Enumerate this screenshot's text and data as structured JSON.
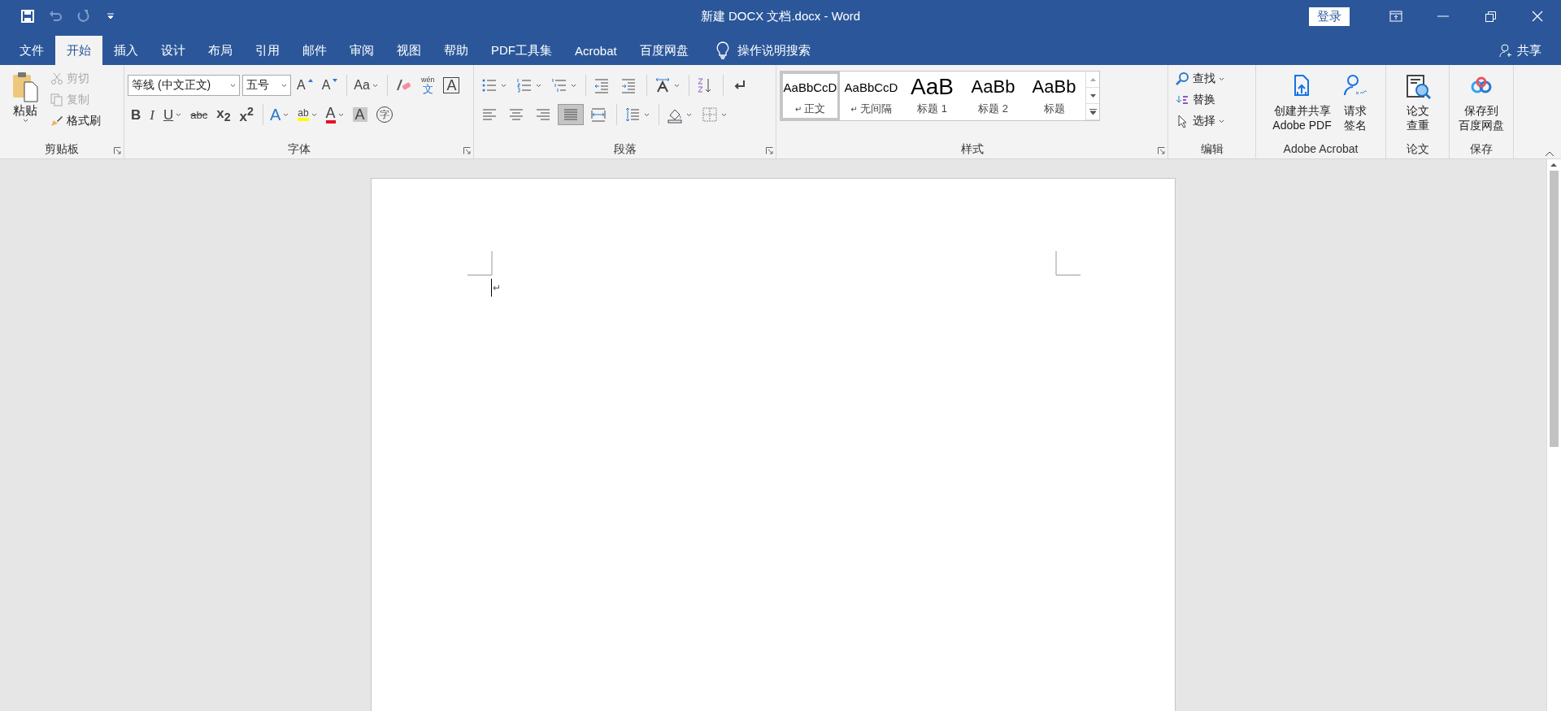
{
  "window": {
    "title": "新建 DOCX 文档.docx  -  Word",
    "sign_in": "登录"
  },
  "quick_access": [
    {
      "kind": "save",
      "disabled": false
    },
    {
      "kind": "undo",
      "disabled": true
    },
    {
      "kind": "redo",
      "disabled": true
    },
    {
      "kind": "customize",
      "disabled": false
    }
  ],
  "tabs": [
    {
      "label": "文件",
      "selected": false
    },
    {
      "label": "开始",
      "selected": true
    },
    {
      "label": "插入",
      "selected": false
    },
    {
      "label": "设计",
      "selected": false
    },
    {
      "label": "布局",
      "selected": false
    },
    {
      "label": "引用",
      "selected": false
    },
    {
      "label": "邮件",
      "selected": false
    },
    {
      "label": "审阅",
      "selected": false
    },
    {
      "label": "视图",
      "selected": false
    },
    {
      "label": "帮助",
      "selected": false
    },
    {
      "label": "PDF工具集",
      "selected": false
    },
    {
      "label": "Acrobat",
      "selected": false
    },
    {
      "label": "百度网盘",
      "selected": false
    }
  ],
  "tell_me": "操作说明搜索",
  "share": "共享",
  "clipboard": {
    "label": "剪贴板",
    "paste": "粘贴",
    "items": [
      {
        "kind": "cut",
        "label": "剪切",
        "disabled": true
      },
      {
        "kind": "copy",
        "label": "复制",
        "disabled": true
      },
      {
        "kind": "painter",
        "label": "格式刷",
        "disabled": false
      }
    ]
  },
  "font": {
    "label": "字体",
    "name": "等线 (中文正文)",
    "size": "五号",
    "row1": [
      {
        "kind": "grow",
        "glyph": "A",
        "dropdown": false,
        "sep": false
      },
      {
        "kind": "shrink",
        "glyph": "A",
        "dropdown": false,
        "sep": false
      },
      {
        "kind": "case",
        "glyph": "Aa",
        "dropdown": true,
        "sep": true
      },
      {
        "kind": "clear",
        "dropdown": false,
        "sep": true
      },
      {
        "kind": "pinyin",
        "glyph": "文",
        "top": "wén",
        "dropdown": false,
        "sep": false
      },
      {
        "kind": "boxed",
        "glyph": "A",
        "dropdown": false,
        "sep": false
      }
    ],
    "row2": [
      {
        "kind": "bold",
        "glyph": "B",
        "dropdown": false,
        "sep": false
      },
      {
        "kind": "italic",
        "glyph": "I",
        "dropdown": false,
        "sep": false
      },
      {
        "kind": "underline",
        "glyph": "U",
        "dropdown": true,
        "sep": false
      },
      {
        "kind": "strike",
        "glyph": "abc",
        "dropdown": false,
        "sep": false
      },
      {
        "kind": "script",
        "glyph": "x$_{2}$",
        "dropdown": false,
        "sep": false
      },
      {
        "kind": "script",
        "glyph": "x$^{2}$",
        "dropdown": false,
        "sep": false
      },
      {
        "kind": "outline",
        "glyph": "A",
        "dropdown": true,
        "sep": true
      },
      {
        "kind": "highlight",
        "glyph": "ab",
        "dropdown": true,
        "sep": false
      },
      {
        "kind": "color",
        "glyph": "A",
        "dropdown": true,
        "sep": false
      },
      {
        "kind": "shaded",
        "glyph": "A",
        "dropdown": false,
        "sep": false
      },
      {
        "kind": "enclosed",
        "glyph": "字",
        "dropdown": false,
        "sep": false
      }
    ]
  },
  "paragraph": {
    "label": "段落",
    "row1": [
      {
        "kind": "bullets",
        "dropdown": true,
        "sep": false,
        "selected": false
      },
      {
        "kind": "numbering",
        "dropdown": true,
        "sep": false,
        "selected": false
      },
      {
        "kind": "multilevel",
        "dropdown": true,
        "sep": false,
        "selected": false
      },
      {
        "kind": "outdent",
        "dropdown": false,
        "sep": true,
        "selected": false
      },
      {
        "kind": "indent",
        "dropdown": false,
        "sep": false,
        "selected": false
      },
      {
        "kind": "asian",
        "dropdown": true,
        "sep": true,
        "selected": false
      },
      {
        "kind": "sort",
        "dropdown": false,
        "sep": true,
        "selected": false
      },
      {
        "kind": "marks",
        "dropdown": false,
        "sep": true,
        "selected": false
      }
    ],
    "row2": [
      {
        "kind": "left",
        "dropdown": false,
        "sep": false,
        "selected": false
      },
      {
        "kind": "center",
        "dropdown": false,
        "sep": false,
        "selected": false
      },
      {
        "kind": "right",
        "dropdown": false,
        "sep": false,
        "selected": false
      },
      {
        "kind": "justify",
        "dropdown": false,
        "sep": false,
        "selected": true
      },
      {
        "kind": "distributed",
        "dropdown": false,
        "sep": false,
        "selected": false
      },
      {
        "kind": "spacing",
        "dropdown": true,
        "sep": true,
        "selected": false
      },
      {
        "kind": "shading",
        "dropdown": true,
        "sep": true,
        "selected": false
      },
      {
        "kind": "borders",
        "dropdown": true,
        "sep": false,
        "selected": false
      }
    ]
  },
  "styles": {
    "label": "样式",
    "items": [
      {
        "preview": "AaBbCcD",
        "name": "正文",
        "mark": "↵",
        "kind": "normal",
        "selected": true
      },
      {
        "preview": "AaBbCcD",
        "name": "无间隔",
        "mark": "↵",
        "kind": "normal",
        "selected": false
      },
      {
        "preview": "AaB",
        "name": "标题 1",
        "kind": "heading1",
        "selected": false
      },
      {
        "preview": "AaBb",
        "name": "标题 2",
        "kind": "heading2",
        "selected": false
      },
      {
        "preview": "AaBb",
        "name": "标题",
        "kind": "title",
        "selected": false
      }
    ]
  },
  "editing": {
    "label": "编辑",
    "items": [
      {
        "kind": "find",
        "label": "查找",
        "dropdown": true
      },
      {
        "kind": "replace",
        "label": "替换",
        "dropdown": false
      },
      {
        "kind": "select",
        "label": "选择",
        "dropdown": true
      }
    ]
  },
  "big_groups": [
    {
      "label": "Adobe Acrobat",
      "buttons": [
        {
          "kind": "pdf",
          "lines": [
            "创建并共享",
            "Adobe PDF"
          ]
        },
        {
          "kind": "sign",
          "lines": [
            "请求",
            "签名"
          ]
        }
      ]
    },
    {
      "label": "论文",
      "buttons": [
        {
          "kind": "check",
          "lines": [
            "论文",
            "查重"
          ]
        }
      ]
    },
    {
      "label": "保存",
      "buttons": [
        {
          "kind": "cloud",
          "lines": [
            "保存到",
            "百度网盘"
          ]
        }
      ]
    }
  ],
  "document": {
    "paragraph_mark": "↵"
  }
}
